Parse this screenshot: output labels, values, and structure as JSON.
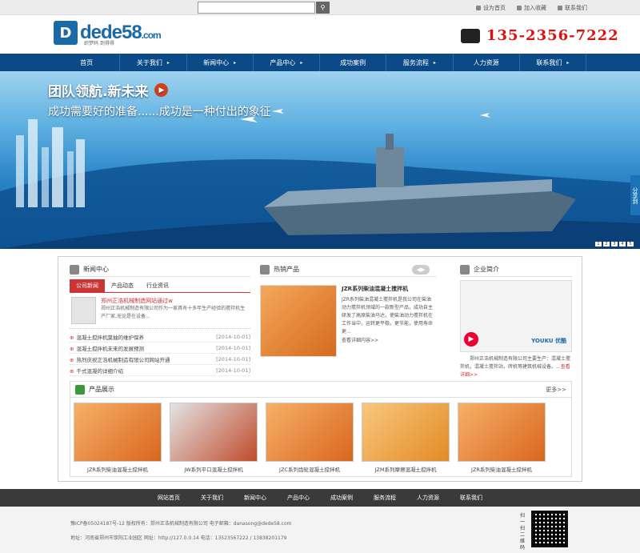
{
  "topbar": {
    "links": [
      "设为首页",
      "加入收藏",
      "联系我们"
    ]
  },
  "header": {
    "logo_main": "dede58",
    "logo_suffix": ".com",
    "logo_sub": "织梦码 到得得",
    "phone": "135-2356-7222"
  },
  "nav": {
    "items": [
      {
        "label": "首页",
        "caret": false
      },
      {
        "label": "关于我们",
        "caret": true
      },
      {
        "label": "新闻中心",
        "caret": true
      },
      {
        "label": "产品中心",
        "caret": true
      },
      {
        "label": "成功案例",
        "caret": false
      },
      {
        "label": "服务流程",
        "caret": true
      },
      {
        "label": "人力资源",
        "caret": false
      },
      {
        "label": "联系我们",
        "caret": true
      }
    ]
  },
  "banner": {
    "title": "团队领航.新未来",
    "subtitle": "成功需要好的准备......成功是一种付出的象征",
    "share": "分享到",
    "dots": [
      "1",
      "2",
      "3",
      "4",
      "5"
    ]
  },
  "news": {
    "title": "新闻中心",
    "tabs": [
      "公司新闻",
      "产品动态",
      "行业资讯"
    ],
    "feature_title": "郑州正浩机械制造网站通过w",
    "feature_desc": "郑州正浩机械制造有限公司作为一家具有十多年生产经验的搅拌机生产厂家,无论是在设备...",
    "items": [
      {
        "title": "混凝土搅拌机莫抽的维护保养",
        "date": "[2014-10-01]"
      },
      {
        "title": "混凝土搅拌机未来的发展预测",
        "date": "[2014-10-01]"
      },
      {
        "title": "热烈庆祝正浩机械制造有限公司网站开通",
        "date": "[2014-10-01]"
      },
      {
        "title": "千式混凝的详细介绍",
        "date": "[2014-10-01]"
      }
    ]
  },
  "hot": {
    "title": "热销产品",
    "product_title": "JZR系列柴油混凝土搅拌机",
    "desc": "JZR系列柴油混凝土搅拌机是我公司在柴油动力搅拌机领域的一款新型产品，成功自主研发了高原柴油马达，使柴油动力搅拌机在工作当中，运转更平稳，更节能，使用寿命更...",
    "more": "查看详细内容>>"
  },
  "company": {
    "title": "企业简介",
    "video_brand": "YOUKU 优酷",
    "desc": "郑州正浩机械制造有限公司主要生产：混凝土搅拌机，混凝土搅拌站，砖机等建筑机械设备。...",
    "more": "查看详细>>"
  },
  "products": {
    "title": "产品展示",
    "more": "更多>>",
    "items": [
      {
        "name": "JZR系列柴油混凝土搅拌机"
      },
      {
        "name": "JW系列平口混凝土搅拌机"
      },
      {
        "name": "JZC系列齿轮混凝土搅拌机"
      },
      {
        "name": "JZM系列摩擦混凝土搅拌机"
      },
      {
        "name": "JZR系列柴油混凝土搅拌机"
      }
    ]
  },
  "footer": {
    "nav": [
      "网站首页",
      "关于我们",
      "新闻中心",
      "产品中心",
      "成功案例",
      "服务流程",
      "人力资源",
      "联系我们"
    ],
    "line1": "豫ICP备05024187号-12 版权所有：郑州正浩机械制造有限公司 电子邮箱：danasong@dede58.com",
    "line2": "地址：河南省郑州市荥阳工业园区 网址：http://127.0.0.14 电话：13523567222 / 13838201179",
    "qr_label": "扫一扫二维码"
  }
}
